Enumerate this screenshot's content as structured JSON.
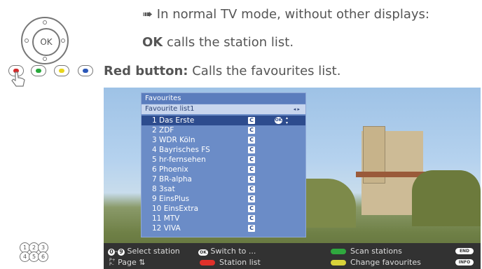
{
  "manual": {
    "bullet_text": "➠ In normal TV mode, without other displays:",
    "ok_key": "OK",
    "ok_text": " calls the station list.",
    "red_key": "Red button:",
    "red_text": " Calls the favourites list."
  },
  "remote": {
    "ok_label": "OK",
    "color_buttons": [
      {
        "name": "red",
        "color": "#d42a2a"
      },
      {
        "name": "green",
        "color": "#27a83a"
      },
      {
        "name": "yellow",
        "color": "#e8d51c"
      },
      {
        "name": "blue",
        "color": "#2b57b8"
      }
    ],
    "numpad": [
      "1",
      "2",
      "3",
      "4",
      "5",
      "6"
    ]
  },
  "favourites": {
    "title": "Favourites",
    "list_name": "Favourite list1",
    "c_badge": "C",
    "ok_badge": "OK",
    "stations": [
      "1 Das Erste",
      "2 ZDF",
      "3 WDR Köln",
      "4 Bayrisches FS",
      "5 hr-fernsehen",
      "6 Phoenix",
      "7 BR-alpha",
      "8 3sat",
      "9 EinsPlus",
      "10 EinsExtra",
      "11 MTV",
      "12 VIVA"
    ],
    "selected_index": 0
  },
  "infobar": {
    "num_start": "0",
    "num_end": "9",
    "select_station": "Select station",
    "page": "Page",
    "page_prefix": "P+\nP–",
    "page_arrows": "⇅",
    "ok_badge": "OK",
    "switch_to": "Switch to ...",
    "station_list": "Station list",
    "scan_stations": "Scan stations",
    "change_favourites": "Change favourites",
    "end_key": "END",
    "info_key": "INFO",
    "colors": {
      "red": "#e0302a",
      "green": "#2fa83e",
      "yellow": "#d8d23a"
    }
  }
}
